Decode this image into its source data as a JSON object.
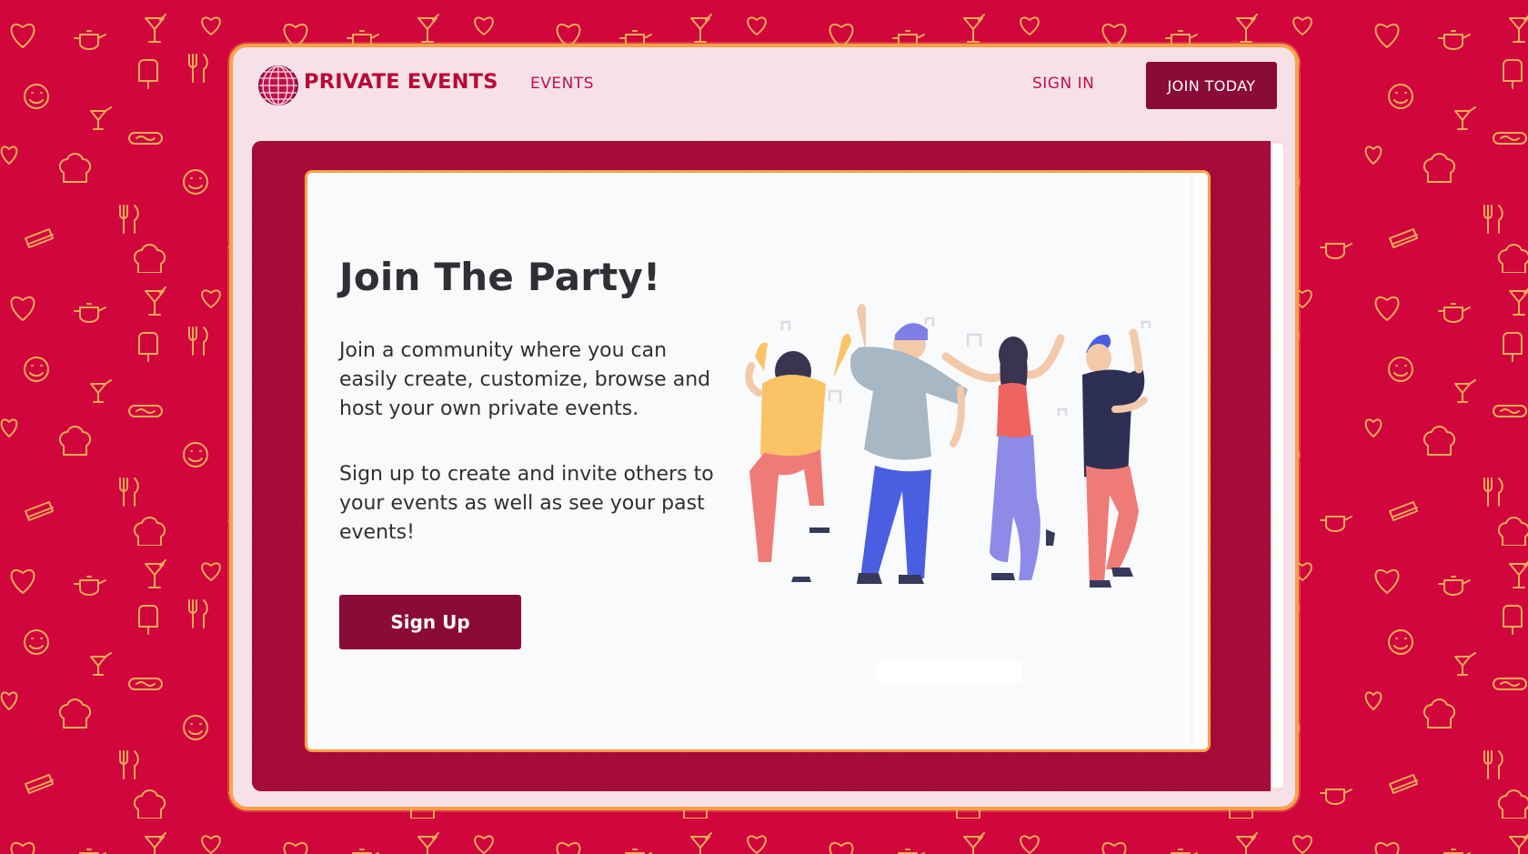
{
  "background": {
    "color": "#d0063c",
    "pattern_color": "#f4c85b",
    "pattern_icons": [
      "heart-icon",
      "teapot-icon",
      "cocktail-icon",
      "popsicle-icon",
      "fork-knife-icon",
      "smiley-icon",
      "hotdog-icon",
      "chef-hat-icon",
      "sandwich-icon"
    ]
  },
  "navbar": {
    "brand": "PRIVATE EVENTS",
    "brand_icon": "disco-ball-icon",
    "events_link": "EVENTS",
    "sign_in_link": "SIGN IN",
    "join_button": "JOIN TODAY"
  },
  "colors": {
    "brand": "#b8083c",
    "button": "#8a0a38",
    "frame": "#f6a14a",
    "stage": "#a80c3a",
    "nav_bg": "#f5e1e7"
  },
  "hero": {
    "heading": "Join The Party!",
    "paragraph_1": "Join a community where you can easily create, customize, browse and host your own private events.",
    "paragraph_2": "Sign up to create and invite others to your events as well as see your past events!",
    "signup_button": "Sign Up",
    "illustration": "dancing-people-illustration"
  }
}
